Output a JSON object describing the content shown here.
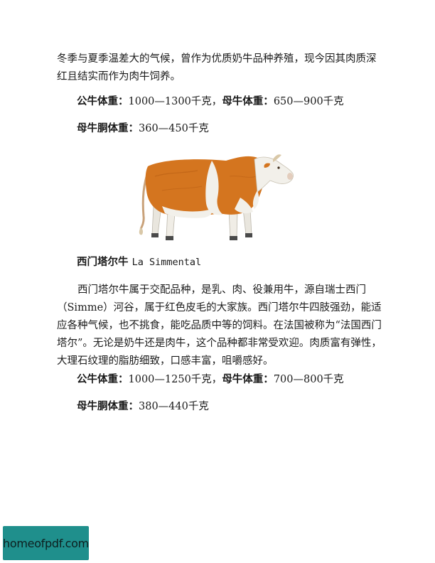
{
  "section1": {
    "intro_text": "冬季与夏季温差大的气候，曾作为优质奶牛品种养殖，现今因其肉质深红且结实而作为肉牛饲养。",
    "bull_weight_label": "公牛体重：",
    "bull_weight_value": "1000—1300千克，",
    "cow_weight_label": "母牛体重：",
    "cow_weight_value": "650—900千克",
    "cow_carcass_label": "母牛胴体重：",
    "cow_carcass_value": "360—450千克"
  },
  "section2": {
    "title_cn": "西门塔尔牛 ",
    "title_latin": "La Simmental",
    "body_text": "西门塔尔牛属于交配品种，是乳、肉、役兼用牛，源自瑞士西门（Simme）河谷，属于红色皮毛的大家族。西门塔尔牛四肢强劲，能适应各种气候，也不挑食，能吃品质中等的饲料。在法国被称为“法国西门塔尔”。无论是奶牛还是肉牛，这个品种都非常受欢迎。肉质富有弹性，大理石纹理的脂肪细致，口感丰富，咀嚼感好。",
    "bull_weight_label": "公牛体重：",
    "bull_weight_value": "1000—1250千克，",
    "cow_weight_label": "母牛体重：",
    "cow_weight_value": "700—800千克",
    "cow_carcass_label": "母牛胴体重：",
    "cow_carcass_value": "380—440千克"
  },
  "illustration": {
    "icon": "cow-illustration",
    "colors": {
      "coat_orange": "#d4751f",
      "coat_white": "#f2f0ea",
      "hoof": "#4a4a4a"
    }
  },
  "watermark": {
    "text": "homeofpdf.com",
    "background": "#1f8f8c"
  }
}
